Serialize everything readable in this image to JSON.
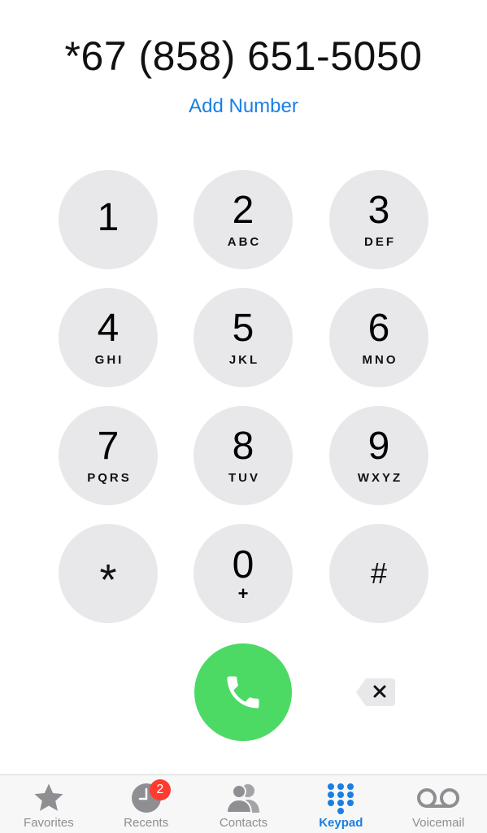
{
  "dialed_number": "*67 (858) 651-5050",
  "add_number_label": "Add Number",
  "keypad": {
    "k1": {
      "digit": "1",
      "letters": ""
    },
    "k2": {
      "digit": "2",
      "letters": "ABC"
    },
    "k3": {
      "digit": "3",
      "letters": "DEF"
    },
    "k4": {
      "digit": "4",
      "letters": "GHI"
    },
    "k5": {
      "digit": "5",
      "letters": "JKL"
    },
    "k6": {
      "digit": "6",
      "letters": "MNO"
    },
    "k7": {
      "digit": "7",
      "letters": "PQRS"
    },
    "k8": {
      "digit": "8",
      "letters": "TUV"
    },
    "k9": {
      "digit": "9",
      "letters": "WXYZ"
    },
    "star": {
      "digit": "*"
    },
    "k0": {
      "digit": "0",
      "letters": "+"
    },
    "hash": {
      "digit": "#"
    }
  },
  "call_button": {
    "icon": "phone-icon",
    "color": "#4cd964"
  },
  "delete_button": {
    "icon": "backspace-icon"
  },
  "tabbar": {
    "active_color": "#1a7fe0",
    "inactive_color": "#8e8e93",
    "tabs": [
      {
        "label": "Favorites",
        "icon": "star-icon"
      },
      {
        "label": "Recents",
        "icon": "clock-icon",
        "badge": "2"
      },
      {
        "label": "Contacts",
        "icon": "contacts-icon"
      },
      {
        "label": "Keypad",
        "icon": "keypad-icon",
        "active": true
      },
      {
        "label": "Voicemail",
        "icon": "voicemail-icon"
      }
    ]
  }
}
